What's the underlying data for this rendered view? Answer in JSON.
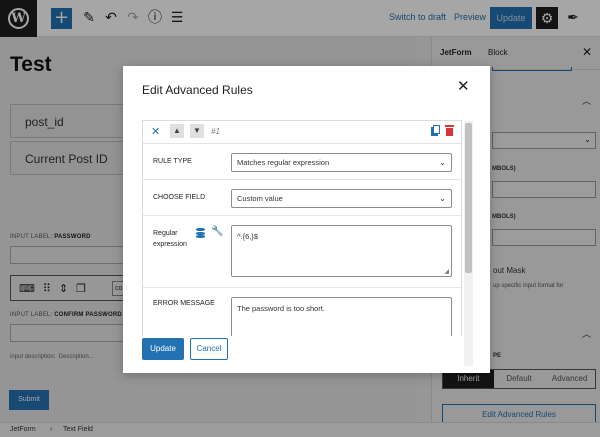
{
  "toolbar": {
    "logo_icon": "wordpress-logo-icon",
    "add_symbol": "+",
    "tools_icon": "✎",
    "undo_icon": "↶",
    "redo_icon": "↷",
    "info_icon": "ⓘ",
    "list_icon": "☰",
    "switch_to_draft": "Switch to draft",
    "preview": "Preview",
    "update": "Update",
    "settings_icon": "⚙",
    "brush_icon": "✒"
  },
  "canvas": {
    "post_title": "Test",
    "field_post_id": "post_id",
    "field_current_post_id": "Current Post ID",
    "password_label_prefix": "INPUT LABEL:",
    "password_label": "PASSWORD",
    "confirm_label_prefix": "INPUT LABEL:",
    "confirm_label": "CONFIRM PASSWORD",
    "block_text_fragment": "co",
    "description_label": "input description:",
    "description_placeholder": "Description...",
    "submit_label": "Submit"
  },
  "sidebar": {
    "tab_jetform": "JetForm",
    "tab_block": "Block",
    "close_icon": "✕",
    "symbols_text_1": "MBOLS)",
    "symbols_text_2": "MBOLS)",
    "input_mask_label": "out Mask",
    "input_mask_desc": "up specific input format for",
    "pe_label": "PE",
    "segments": [
      "Inherit",
      "Default",
      "Advanced"
    ],
    "active_segment": "Inherit",
    "edit_rules_button": "Edit Advanced Rules"
  },
  "footer": {
    "breadcrumb_root": "JetForm",
    "breadcrumb_sep": "›",
    "breadcrumb_leaf": "Text Field"
  },
  "modal": {
    "title": "Edit Advanced Rules",
    "close_icon": "✕",
    "rule": {
      "remove_icon": "✕",
      "up_icon": "▲",
      "down_icon": "▼",
      "number": "#1",
      "rule_type_label": "RULE TYPE",
      "rule_type_value": "Matches regular expression",
      "choose_field_label": "CHOOSE FIELD",
      "choose_field_value": "Custom value",
      "regex_label_line1": "Regular",
      "regex_label_line2": "expression",
      "regex_value": "^.{6,}$",
      "error_message_label": "ERROR MESSAGE",
      "error_message_value": "The password is too short."
    },
    "update_button": "Update",
    "cancel_button": "Cancel"
  },
  "colors": {
    "accent": "#2271b1",
    "danger": "#d63638",
    "dark": "#1e1e1e"
  }
}
